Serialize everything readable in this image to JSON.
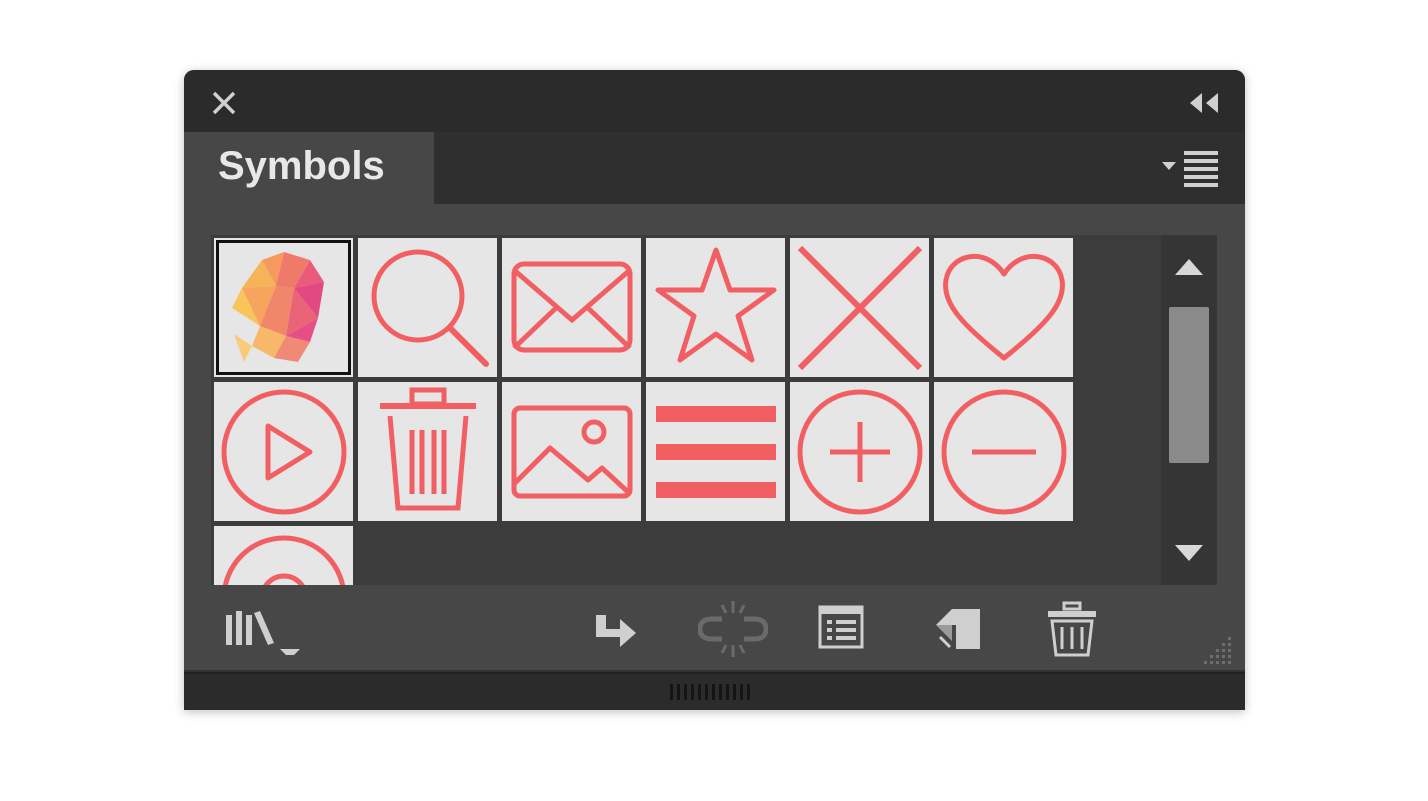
{
  "panel": {
    "tab_title": "Symbols"
  },
  "icons": {
    "close": "close-icon",
    "collapse": "collapse-double-arrow-icon",
    "panel_menu": "panel-menu-icon",
    "scroll_up": "scroll-up-arrow-icon",
    "scroll_down": "scroll-down-arrow-icon",
    "libraries": "symbol-libraries-menu-icon",
    "place": "place-symbol-instance-icon",
    "break_link": "break-link-to-symbol-icon",
    "options": "symbol-options-icon",
    "new": "new-symbol-icon",
    "delete": "delete-symbol-icon",
    "resize": "resize-grip-icon",
    "dock_grip": "dock-grip-icon"
  },
  "symbols": [
    {
      "name": "fox-logo-symbol",
      "selected": true
    },
    {
      "name": "search-symbol"
    },
    {
      "name": "mail-symbol"
    },
    {
      "name": "star-symbol"
    },
    {
      "name": "close-symbol"
    },
    {
      "name": "heart-symbol"
    },
    {
      "name": "play-symbol"
    },
    {
      "name": "trash-symbol"
    },
    {
      "name": "image-symbol"
    },
    {
      "name": "menu-symbol"
    },
    {
      "name": "add-symbol"
    },
    {
      "name": "remove-symbol"
    },
    {
      "name": "target-symbol"
    }
  ],
  "colors": {
    "symbol_stroke": "#f25f63",
    "panel_bg": "#474747",
    "cell_bg": "#e6e6e6"
  }
}
